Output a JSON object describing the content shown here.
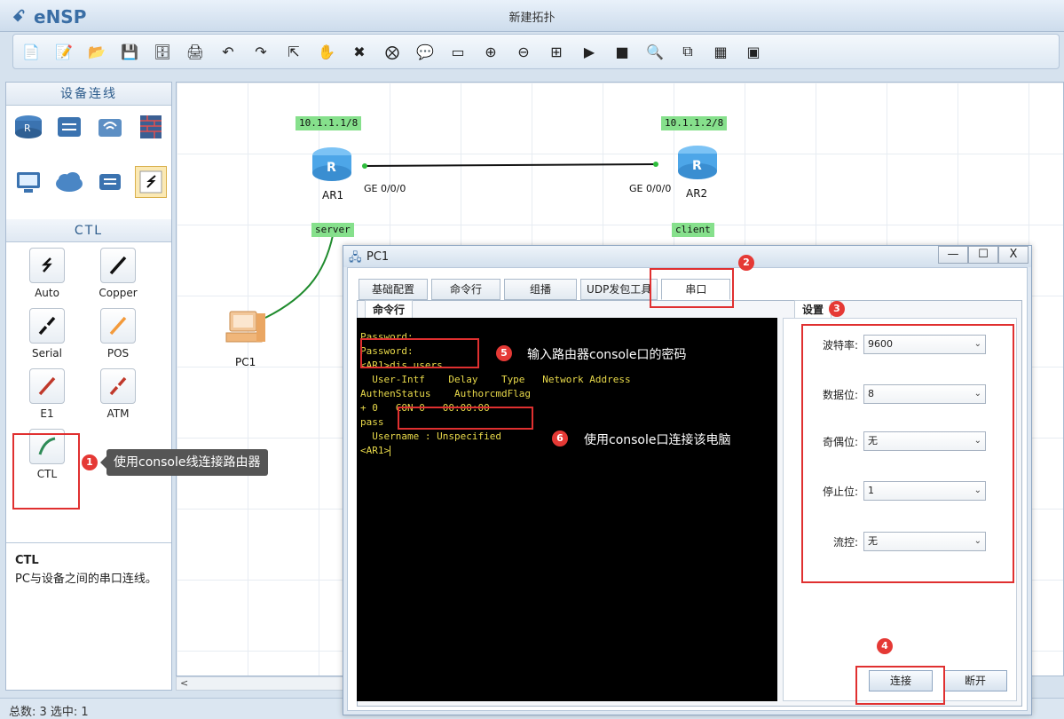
{
  "app": {
    "name": "eNSP",
    "window_title": "新建拓扑"
  },
  "toolbar": {
    "buttons": [
      {
        "name": "new-topology-icon",
        "glyph": "📄"
      },
      {
        "name": "new-test-icon",
        "glyph": "📝"
      },
      {
        "name": "open-icon",
        "glyph": "📂"
      },
      {
        "name": "save-icon",
        "glyph": "💾"
      },
      {
        "name": "save-as-icon",
        "glyph": "🗄"
      },
      {
        "name": "print-icon",
        "glyph": "🖨"
      },
      {
        "name": "undo-icon",
        "glyph": "↶"
      },
      {
        "name": "redo-icon",
        "glyph": "↷"
      },
      {
        "name": "pointer-icon",
        "glyph": "⇱"
      },
      {
        "name": "hand-icon",
        "glyph": "✋"
      },
      {
        "name": "delete-icon",
        "glyph": "✖"
      },
      {
        "name": "delete-link-icon",
        "glyph": "⨂"
      },
      {
        "name": "text-note-icon",
        "glyph": "💬"
      },
      {
        "name": "palette-icon",
        "glyph": "▭"
      },
      {
        "name": "zoom-in-icon",
        "glyph": "⊕"
      },
      {
        "name": "zoom-out-icon",
        "glyph": "⊖"
      },
      {
        "name": "fit-icon",
        "glyph": "⊞"
      },
      {
        "name": "start-icon",
        "glyph": "▶"
      },
      {
        "name": "stop-icon",
        "glyph": "■"
      },
      {
        "name": "capture-icon",
        "glyph": "🔍"
      },
      {
        "name": "topology-icon",
        "glyph": "⧉"
      },
      {
        "name": "grid-icon",
        "glyph": "▦"
      },
      {
        "name": "screenshot-icon",
        "glyph": "▣"
      }
    ]
  },
  "left_panel": {
    "device_section_title": "设备连线",
    "cable_section_title": "CTL",
    "cables": [
      {
        "label": "Auto"
      },
      {
        "label": "Copper"
      },
      {
        "label": "Serial"
      },
      {
        "label": "POS"
      },
      {
        "label": "E1"
      },
      {
        "label": "ATM"
      },
      {
        "label": "CTL"
      }
    ],
    "info": {
      "title": "CTL",
      "description": "PC与设备之间的串口连线。"
    }
  },
  "canvas": {
    "ar1": {
      "name": "AR1",
      "ip": "10.1.1.1/8",
      "port": "GE 0/0/0",
      "role": "server"
    },
    "ar2": {
      "name": "AR2",
      "ip": "10.1.1.2/8",
      "port": "GE 0/0/0",
      "role": "client"
    },
    "pc1": {
      "name": "PC1"
    },
    "scroll_arrow": "<"
  },
  "annotations": {
    "n1": "1",
    "n2": "2",
    "n3": "3",
    "n4": "4",
    "n5": "5",
    "n6": "6",
    "callout1": "使用console线连接路由器",
    "note5": "输入路由器console口的密码",
    "note6": "使用console口连接该电脑"
  },
  "dialog": {
    "title": "PC1",
    "min": "—",
    "max": "☐",
    "close": "X",
    "tabs": [
      "基础配置",
      "命令行",
      "组播",
      "UDP发包工具",
      "串口"
    ],
    "active_tab": "串口",
    "terminal_tab": "命令行",
    "settings_tab": "设置",
    "terminal_lines": [
      "Password:",
      "Password:",
      "<AR1>dis users",
      "  User-Intf    Delay    Type   Network Address",
      "AuthenStatus    AuthorcmdFlag",
      "+ 0   CON 0   00:00:00",
      "pass",
      "  Username : Unspecified",
      "",
      "",
      "<AR1>"
    ],
    "settings": [
      {
        "label": "波特率:",
        "value": "9600"
      },
      {
        "label": "数据位:",
        "value": "8"
      },
      {
        "label": "奇偶位:",
        "value": "无"
      },
      {
        "label": "停止位:",
        "value": "1"
      },
      {
        "label": "流控:",
        "value": "无"
      }
    ],
    "connect_label": "连接",
    "disconnect_label": "断开"
  },
  "status": {
    "text": "总数: 3 选中: 1"
  }
}
